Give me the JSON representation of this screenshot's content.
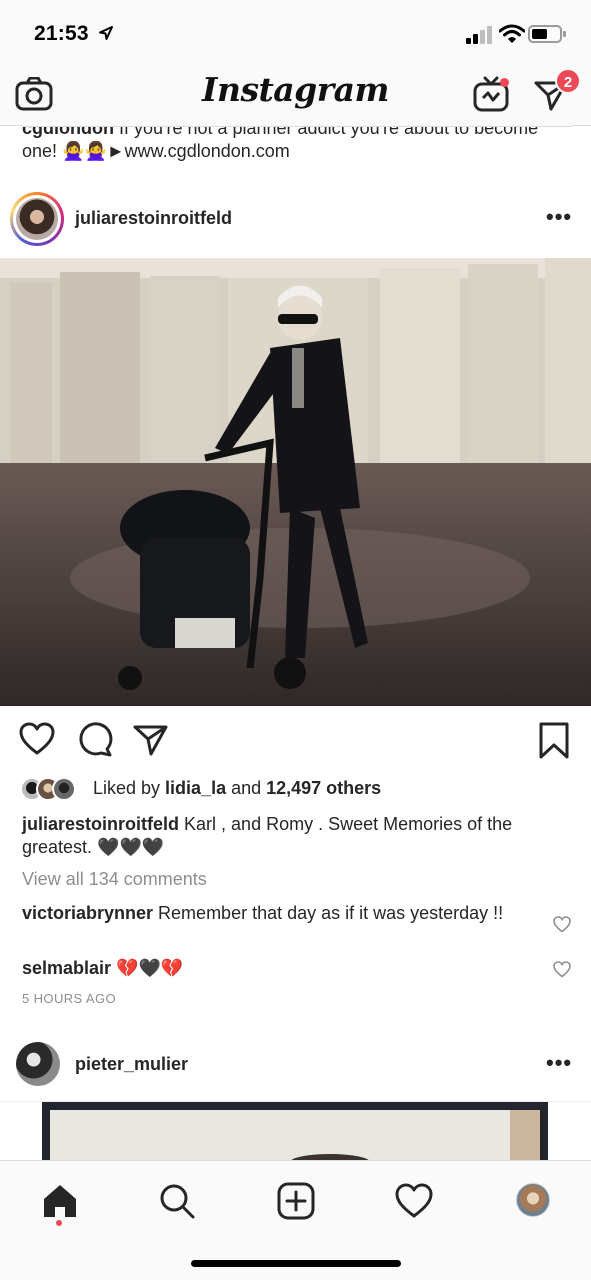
{
  "status_bar": {
    "time": "21:53"
  },
  "app_bar": {
    "logo": "Instagram",
    "dm_badge": "2"
  },
  "previous_post": {
    "caption_user": "cgdlondon",
    "caption_text": "If you're not a planner addict you're about to become one! 🙅‍♀️🙅‍♀️►www.cgdlondon.com"
  },
  "post": {
    "username": "juliarestoinroitfeld",
    "more": "•••",
    "liked_by_prefix": "Liked by ",
    "liked_by_user": "lidia_la",
    "liked_by_mid": " and ",
    "liked_by_count": "12,497 others",
    "caption_user": "juliarestoinroitfeld",
    "caption_text": " Karl , and Romy . Sweet Memories of the greatest. 🖤🖤🖤",
    "view_comments": "View all 134 comments",
    "comments": [
      {
        "user": "victoriabrynner",
        "text": " Remember that day as if it was yesterday !!"
      },
      {
        "user": "selmablair",
        "text": " 💔🖤💔"
      }
    ],
    "timestamp": "5 HOURS AGO"
  },
  "next_post": {
    "username": "pieter_mulier",
    "more": "•••"
  },
  "icons": {
    "top": [
      "camera-icon",
      "igtv-icon",
      "direct-message-icon"
    ],
    "actions": [
      "heart-icon",
      "comment-icon",
      "share-icon",
      "bookmark-icon"
    ],
    "tabs": [
      "home-icon",
      "search-icon",
      "add-post-icon",
      "activity-heart-icon",
      "profile-avatar"
    ]
  },
  "colors": {
    "badge_red": "#ed4956",
    "text": "#262626",
    "muted": "#8e8e8e"
  }
}
